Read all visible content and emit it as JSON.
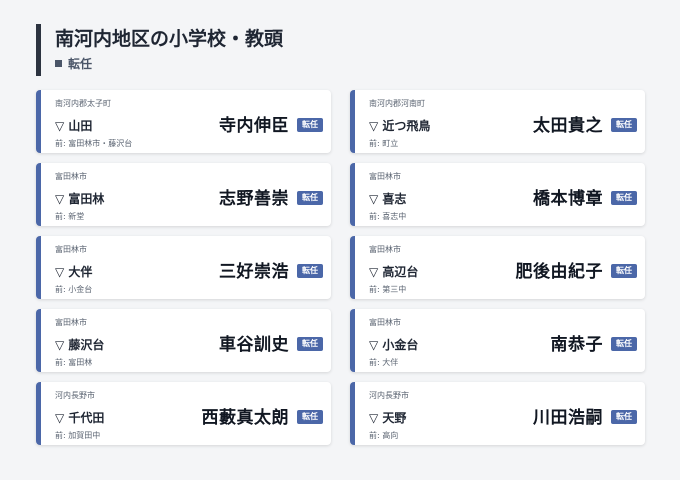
{
  "header": {
    "title": "南河内地区の小学校・教頭",
    "subtitle": "転任"
  },
  "cards": [
    {
      "district": "南河内郡太子町",
      "area": "▽ 山田",
      "name": "寺内伸臣",
      "badge": "転任",
      "prev": "前: 富田林市・藤沢台"
    },
    {
      "district": "南河内郡河南町",
      "area": "▽ 近つ飛鳥",
      "name": "太田貴之",
      "badge": "転任",
      "prev": "前: 町立"
    },
    {
      "district": "富田林市",
      "area": "▽ 富田林",
      "name": "志野善崇",
      "badge": "転任",
      "prev": "前: 新堂"
    },
    {
      "district": "富田林市",
      "area": "▽ 喜志",
      "name": "橋本博章",
      "badge": "転任",
      "prev": "前: 喜志中"
    },
    {
      "district": "富田林市",
      "area": "▽ 大伴",
      "name": "三好崇浩",
      "badge": "転任",
      "prev": "前: 小金台"
    },
    {
      "district": "富田林市",
      "area": "▽ 高辺台",
      "name": "肥後由紀子",
      "badge": "転任",
      "prev": "前: 第三中"
    },
    {
      "district": "富田林市",
      "area": "▽ 藤沢台",
      "name": "車谷訓史",
      "badge": "転任",
      "prev": "前: 富田林"
    },
    {
      "district": "富田林市",
      "area": "▽ 小金台",
      "name": "南恭子",
      "badge": "転任",
      "prev": "前: 大伴"
    },
    {
      "district": "河内長野市",
      "area": "▽ 千代田",
      "name": "西藪真太朗",
      "badge": "転任",
      "prev": "前: 加賀田中"
    },
    {
      "district": "河内長野市",
      "area": "▽ 天野",
      "name": "川田浩嗣",
      "badge": "転任",
      "prev": "前: 高向"
    }
  ]
}
